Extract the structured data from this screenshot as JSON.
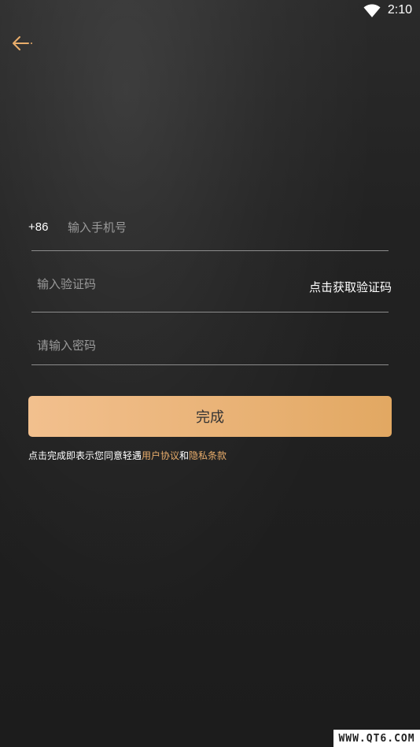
{
  "status_bar": {
    "time": "2:10",
    "wifi_icon": "wifi-icon"
  },
  "header": {
    "back_icon": "arrow-left-icon",
    "accent_color": "#e9ad6b"
  },
  "form": {
    "country_code": "+86",
    "phone_placeholder": "输入手机号",
    "code_placeholder": "输入验证码",
    "get_code_label": "点击获取验证码",
    "password_placeholder": "请输入密码",
    "submit_label": "完成"
  },
  "agreement": {
    "prefix": "点击完成即表示您同意轻遇",
    "user_agreement": "用户协议",
    "conjunction": "和",
    "privacy_policy": "隐私条款"
  },
  "watermark": {
    "text": "WWW.QT6.COM"
  }
}
